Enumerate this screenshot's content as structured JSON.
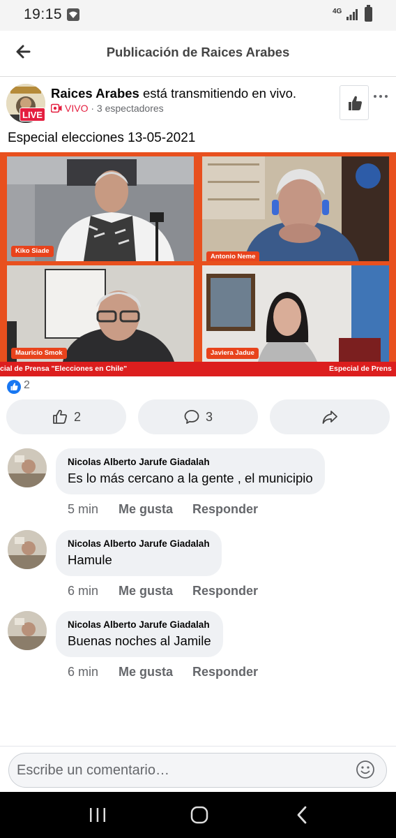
{
  "status_bar": {
    "time": "19:15",
    "network": "4G"
  },
  "header": {
    "title": "Publicación de Raices Arabes"
  },
  "post": {
    "author": "Raices Arabes",
    "action_text": " está transmitiendo en vivo.",
    "live_badge": "LIVE",
    "live_label": "VIVO",
    "separator": " · ",
    "viewers": "3 espectadores",
    "caption": "Especial elecciones 13-05-2021",
    "video": {
      "participants": [
        "Kiko Siade",
        "Antonio Neme",
        "Mauricio Smok",
        "Javiera Jadue"
      ],
      "banner_left": "cial de Prensa \"Elecciones en Chile\"",
      "banner_right": "Especial de Prens"
    },
    "reactions_count": "2",
    "actions": {
      "like_count": "2",
      "comment_count": "3"
    }
  },
  "comments": [
    {
      "author": "Nicolas Alberto Jarufe Giadalah",
      "text": "Es lo más cercano a la gente , el municipio",
      "time": "5 min",
      "like_label": "Me gusta",
      "reply_label": "Responder"
    },
    {
      "author": "Nicolas Alberto Jarufe Giadalah",
      "text": "Hamule",
      "time": "6 min",
      "like_label": "Me gusta",
      "reply_label": "Responder"
    },
    {
      "author": "Nicolas Alberto Jarufe Giadalah",
      "text": "Buenas noches al Jamile",
      "time": "6 min",
      "like_label": "Me gusta",
      "reply_label": "Responder"
    }
  ],
  "composer": {
    "placeholder": "Escribe un comentario…"
  },
  "colors": {
    "brand_blue": "#1877f2",
    "live_red": "#e41e3f",
    "video_orange": "#e8501e"
  }
}
